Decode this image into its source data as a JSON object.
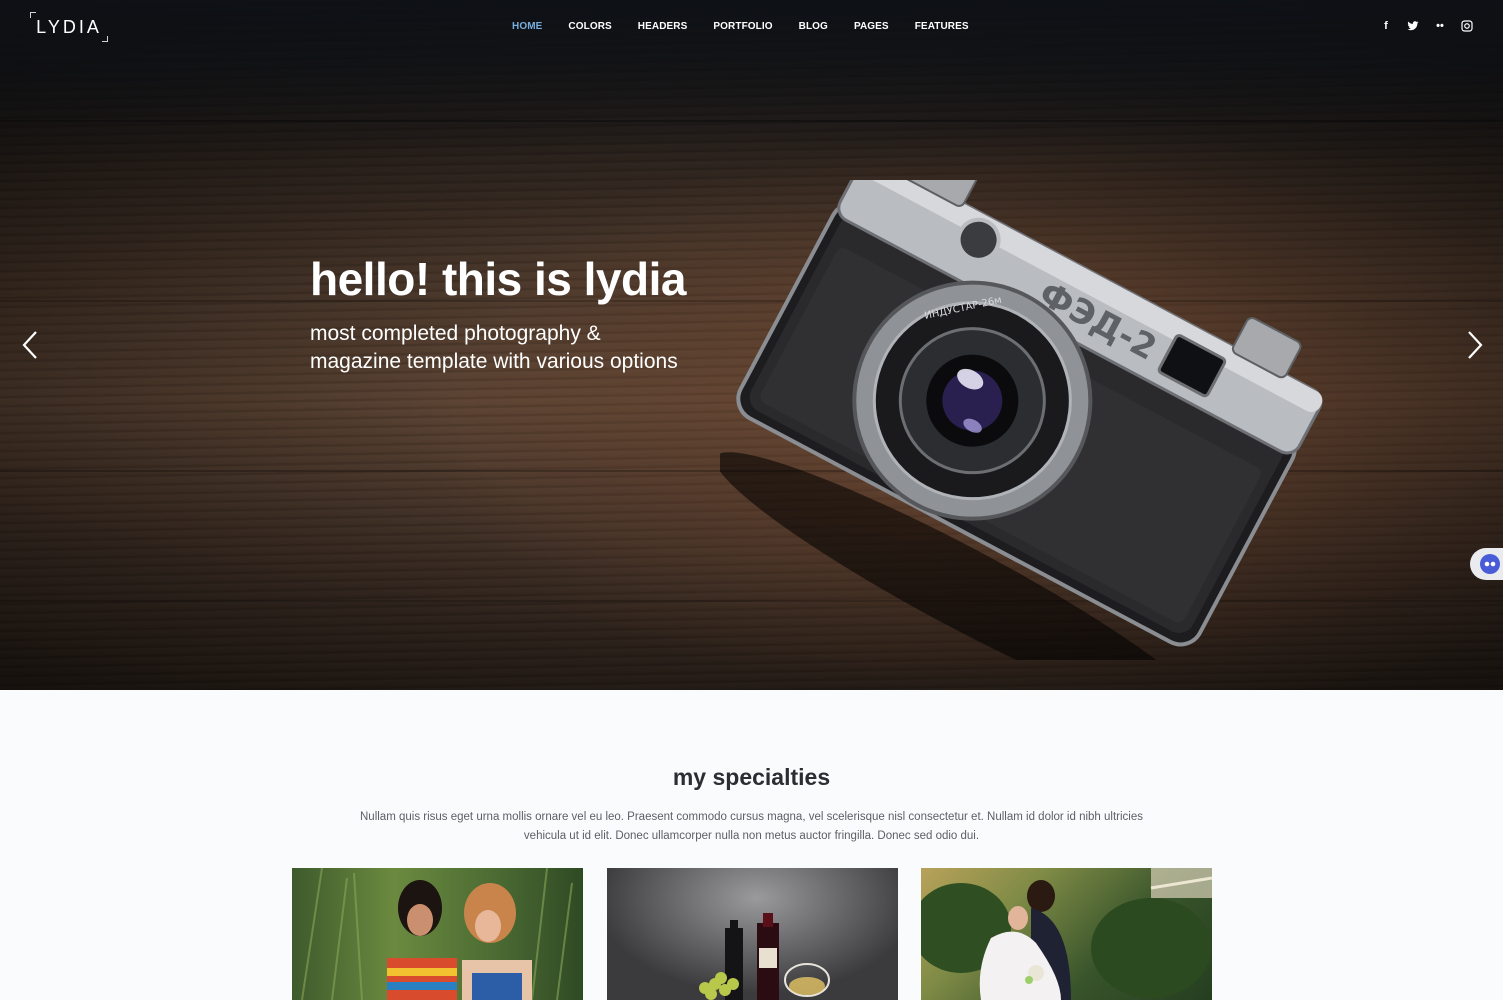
{
  "brand": {
    "logo_text": "LYDIA"
  },
  "nav": {
    "items": [
      {
        "label": "HOME",
        "active": true
      },
      {
        "label": "COLORS",
        "active": false
      },
      {
        "label": "HEADERS",
        "active": false
      },
      {
        "label": "PORTFOLIO",
        "active": false
      },
      {
        "label": "BLOG",
        "active": false
      },
      {
        "label": "PAGES",
        "active": false
      },
      {
        "label": "FEATURES",
        "active": false
      }
    ],
    "active_color": "#78aede"
  },
  "social": {
    "icons": [
      "facebook-icon",
      "twitter-icon",
      "flickr-icon",
      "instagram-icon"
    ],
    "glyphs": [
      "f",
      "t",
      "••",
      "◎"
    ]
  },
  "hero": {
    "title": "hello! this is lydia",
    "subtitle_line1": "most completed photography &",
    "subtitle_line2": "magazine template with various options",
    "camera_engraving": "ФЭД-2",
    "lens_text": "ИНДУСТАР-26м"
  },
  "specialties": {
    "title": "my specialties",
    "description": "Nullam quis risus eget urna mollis ornare vel eu leo. Praesent commodo cursus magna, vel scelerisque nisl consectetur et. Nullam id dolor id nibh ultricies vehicula ut id elit. Donec ullamcorper nulla non metus auctor fringilla. Donec sed odio dui."
  }
}
